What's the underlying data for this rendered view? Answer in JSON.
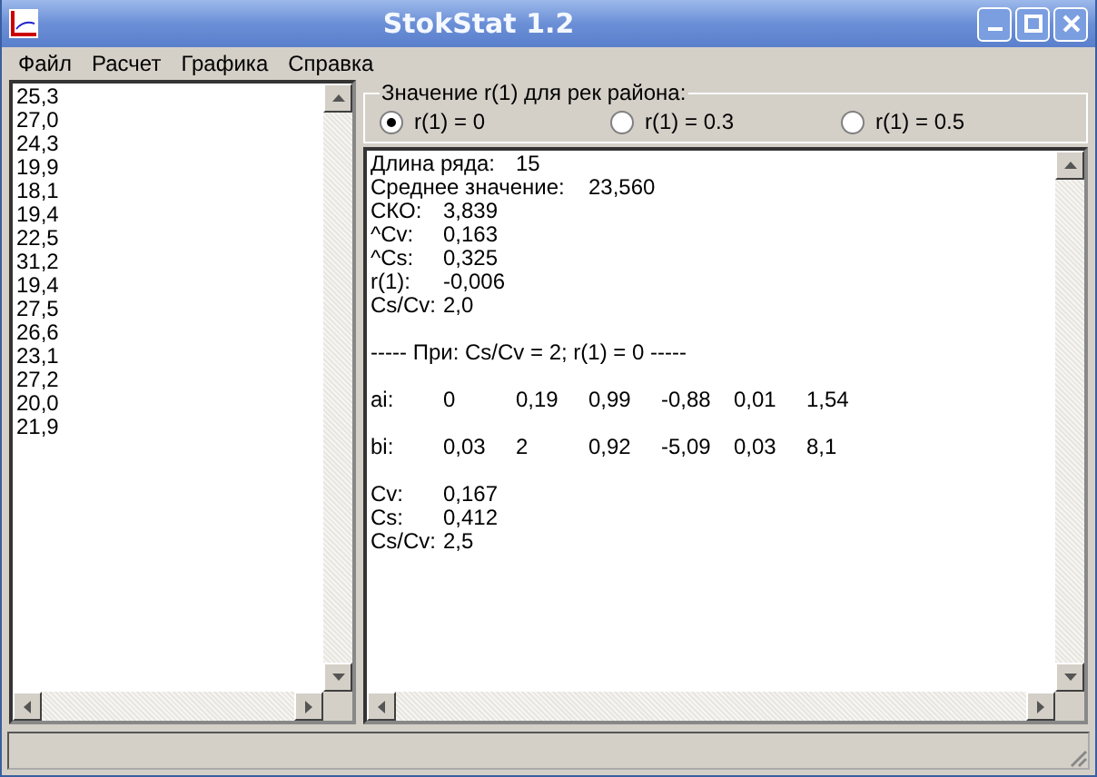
{
  "window": {
    "title": "StokStat 1.2"
  },
  "menu": [
    "Файл",
    "Расчет",
    "Графика",
    "Справка"
  ],
  "series": [
    "25,3",
    "27,0",
    "24,3",
    "19,9",
    "18,1",
    "19,4",
    "22,5",
    "31,2",
    "19,4",
    "27,5",
    "26,6",
    "23,1",
    "27,2",
    "20,0",
    "21,9"
  ],
  "r1_group": {
    "legend": "Значение r(1) для рек района:",
    "options": [
      {
        "label": "r(1) = 0",
        "selected": true
      },
      {
        "label": "r(1) = 0.3",
        "selected": false
      },
      {
        "label": "r(1) = 0.5",
        "selected": false
      }
    ]
  },
  "output_blocks": [
    [
      {
        "kind": "wide",
        "cells": [
          "Длина ряда:",
          "15"
        ]
      },
      {
        "kind": "wider",
        "cells": [
          "Среднее значение:",
          "23,560"
        ]
      },
      {
        "kind": "normal",
        "cells": [
          "СКО:",
          "3,839"
        ]
      },
      {
        "kind": "normal",
        "cells": [
          "^Cv:",
          "0,163"
        ]
      },
      {
        "kind": "normal",
        "cells": [
          "^Cs:",
          "0,325"
        ]
      },
      {
        "kind": "normal",
        "cells": [
          "r(1):",
          "-0,006"
        ]
      },
      {
        "kind": "normal",
        "cells": [
          "Cs/Cv:",
          "2,0"
        ]
      }
    ],
    [
      {
        "kind": "note",
        "cells": [
          "----- При: Cs/Cv = 2; r(1) = 0 -----"
        ]
      }
    ],
    [
      {
        "kind": "normal",
        "cells": [
          "ai:",
          "0",
          "0,19",
          "0,99",
          "-0,88",
          "0,01",
          "1,54"
        ]
      }
    ],
    [
      {
        "kind": "normal",
        "cells": [
          "bi:",
          "0,03",
          "2",
          "0,92",
          "-5,09",
          "0,03",
          "8,1"
        ]
      }
    ],
    [
      {
        "kind": "normal",
        "cells": [
          "Cv:",
          "0,167"
        ]
      },
      {
        "kind": "normal",
        "cells": [
          "Cs:",
          "0,412"
        ]
      },
      {
        "kind": "normal",
        "cells": [
          "Cs/Cv:",
          "2,5"
        ]
      }
    ]
  ]
}
